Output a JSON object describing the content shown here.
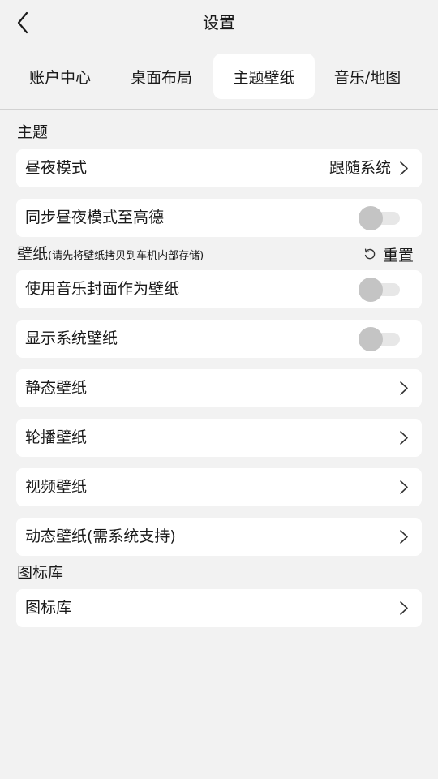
{
  "header": {
    "title": "设置"
  },
  "tabs": [
    {
      "label": "账户中心",
      "active": false
    },
    {
      "label": "桌面布局",
      "active": false
    },
    {
      "label": "主题壁纸",
      "active": true
    },
    {
      "label": "音乐/地图",
      "active": false
    }
  ],
  "theme_section": {
    "title": "主题",
    "day_night_mode": {
      "label": "昼夜模式",
      "value": "跟随系统"
    },
    "sync_day_night": {
      "label": "同步昼夜模式至高德",
      "on": false
    }
  },
  "wallpaper_section": {
    "title": "壁纸",
    "note": "(请先将壁纸拷贝到车机内部存储)",
    "reset_label": "重置",
    "use_music_cover": {
      "label": "使用音乐封面作为壁纸",
      "on": false
    },
    "show_system_wallpaper": {
      "label": "显示系统壁纸",
      "on": false
    },
    "static_wallpaper": {
      "label": "静态壁纸"
    },
    "carousel_wallpaper": {
      "label": "轮播壁纸"
    },
    "video_wallpaper": {
      "label": "视频壁纸"
    },
    "dynamic_wallpaper": {
      "label": "动态壁纸(需系统支持)"
    }
  },
  "icon_section": {
    "title": "图标库",
    "icon_library": {
      "label": "图标库"
    }
  },
  "icons": {
    "back": "back-arrow-icon",
    "chevron": "chevron-right-icon",
    "reset": "reset-icon"
  },
  "colors": {
    "background": "#f2f2f2",
    "card": "#ffffff",
    "text": "#1a1a1a",
    "toggle_knob_off": "#c4c4c4",
    "toggle_track_off": "#e7e7e7"
  }
}
